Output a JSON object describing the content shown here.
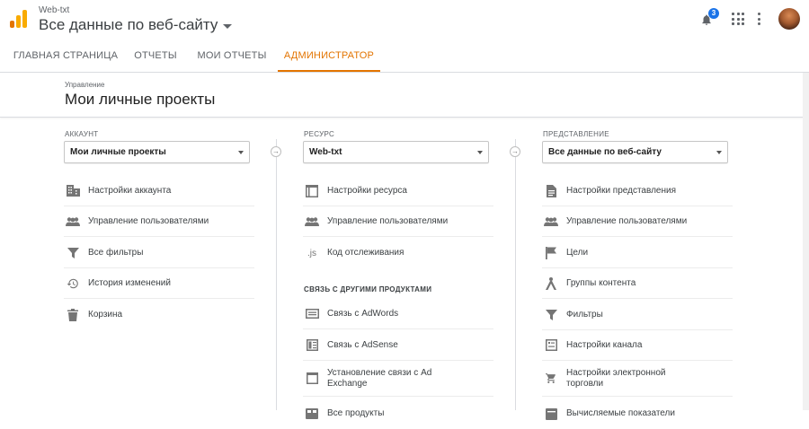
{
  "header": {
    "account_name": "Web-txt",
    "view_title": "Все данные по веб-сайту",
    "notification_count": "3"
  },
  "nav": {
    "tabs": [
      {
        "label": "ГЛАВНАЯ СТРАНИЦА"
      },
      {
        "label": "ОТЧЕТЫ"
      },
      {
        "label": "МОИ ОТЧЕТЫ"
      },
      {
        "label": "АДМИНИСТРАТОР",
        "active": true
      }
    ]
  },
  "subheader": {
    "breadcrumb": "Управление",
    "title": "Мои личные проекты"
  },
  "account_col": {
    "label": "АККАУНТ",
    "selected": "Мои личные проекты",
    "items": [
      {
        "label": "Настройки аккаунта",
        "icon": "building-icon"
      },
      {
        "label": "Управление пользователями",
        "icon": "users-icon"
      },
      {
        "label": "Все фильтры",
        "icon": "filter-icon"
      },
      {
        "label": "История изменений",
        "icon": "history-icon"
      },
      {
        "label": "Корзина",
        "icon": "trash-icon"
      }
    ]
  },
  "property_col": {
    "label": "РЕСУРС",
    "selected": "Web-txt",
    "items": [
      {
        "label": "Настройки ресурса",
        "icon": "window-icon"
      },
      {
        "label": "Управление пользователями",
        "icon": "users-icon"
      },
      {
        "label": "Код отслеживания",
        "icon": "js-icon",
        "glyph": ".js"
      }
    ],
    "section_heading": "СВЯЗЬ С ДРУГИМИ ПРОДУКТАМИ",
    "link_items": [
      {
        "label": "Связь с AdWords",
        "icon": "adwords-icon"
      },
      {
        "label": "Связь с AdSense",
        "icon": "adsense-icon"
      },
      {
        "label": "Установление связи с Ad Exchange",
        "icon": "adexchange-icon"
      },
      {
        "label": "Все продукты",
        "icon": "products-icon"
      }
    ]
  },
  "view_col": {
    "label": "ПРЕДСТАВЛЕНИЕ",
    "selected": "Все данные по веб-сайту",
    "items": [
      {
        "label": "Настройки представления",
        "icon": "document-icon"
      },
      {
        "label": "Управление пользователями",
        "icon": "users-icon"
      },
      {
        "label": "Цели",
        "icon": "flag-icon"
      },
      {
        "label": "Группы контента",
        "icon": "content-group-icon"
      },
      {
        "label": "Фильтры",
        "icon": "filter-icon"
      },
      {
        "label": "Настройки канала",
        "icon": "channel-icon"
      },
      {
        "label": "Настройки электронной торговли",
        "icon": "cart-icon"
      },
      {
        "label": "Вычисляемые показатели",
        "icon": "calculated-icon"
      }
    ]
  },
  "colors": {
    "accent": "#e37400",
    "badge": "#1a73e8"
  }
}
